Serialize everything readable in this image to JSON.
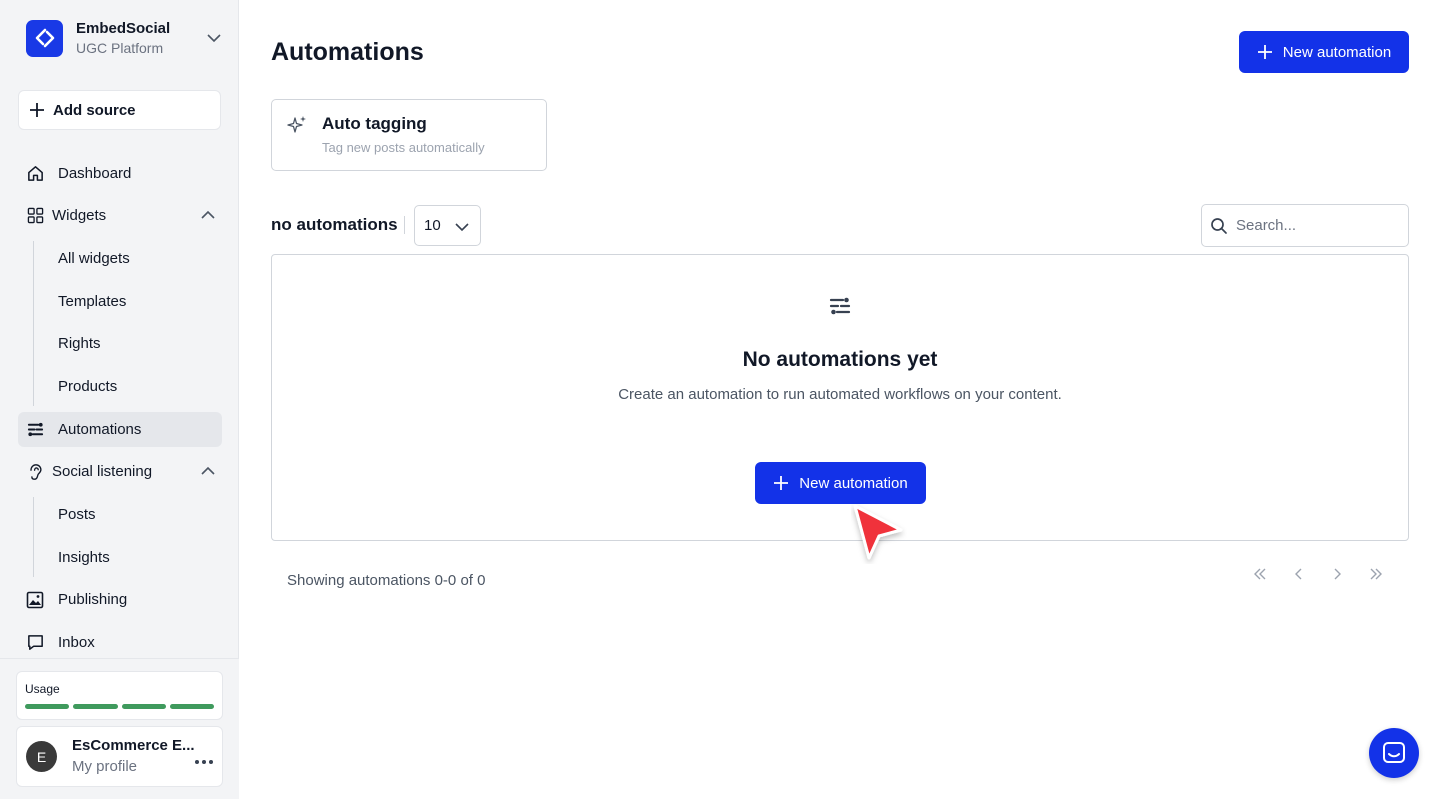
{
  "brand": {
    "name": "EmbedSocial",
    "subtitle": "UGC Platform"
  },
  "sidebar": {
    "add_source": "Add source",
    "items": [
      {
        "label": "Dashboard",
        "icon": "home-icon"
      },
      {
        "label": "Widgets",
        "icon": "grid-icon",
        "expanded": true,
        "children": [
          "All widgets",
          "Templates",
          "Rights",
          "Products"
        ]
      },
      {
        "label": "Automations",
        "icon": "automation-icon",
        "active": true
      },
      {
        "label": "Social listening",
        "icon": "ear-icon",
        "expanded": true,
        "children": [
          "Posts",
          "Insights"
        ]
      },
      {
        "label": "Publishing",
        "icon": "image-icon"
      },
      {
        "label": "Inbox",
        "icon": "chat-bubble-icon"
      }
    ],
    "usage": {
      "label": "Usage",
      "segments": 4,
      "color": "#3f9a5d"
    },
    "profile": {
      "initial": "E",
      "name": "EsCommerce E...",
      "subtitle": "My profile"
    }
  },
  "main": {
    "title": "Automations",
    "new_button": "New automation",
    "template_card": {
      "title": "Auto tagging",
      "subtitle": "Tag new posts automatically"
    },
    "list": {
      "count_label": "no automations",
      "per_page": "10",
      "search_placeholder": "Search..."
    },
    "empty": {
      "title": "No automations yet",
      "description": "Create an automation to run automated workflows on your content.",
      "button": "New automation"
    },
    "footer": {
      "showing": "Showing automations 0-0 of 0"
    }
  },
  "colors": {
    "primary": "#1332e8",
    "sidebar_bg": "#f3f4f6",
    "cursor": "#f0303a"
  }
}
